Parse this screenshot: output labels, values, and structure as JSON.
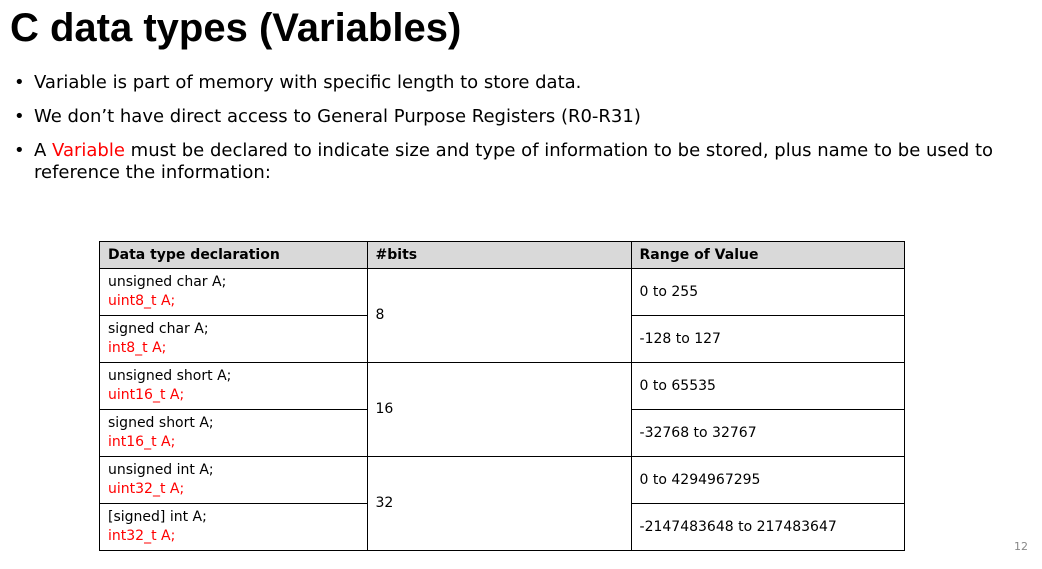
{
  "slide": {
    "title": "C data types (Variables)",
    "page_number": "12",
    "colors": {
      "accent": "#ff0000",
      "header_bg": "#d9d9d9"
    }
  },
  "bullets": [
    {
      "text": "Variable is part of memory with specific length to store data."
    },
    {
      "text": "We don’t have direct access to General Purpose Registers (R0-R31)"
    },
    {
      "pre": "A ",
      "highlight": "Variable",
      "post": " must be declared to indicate size and type of information to be stored, plus name to be used to reference the information:"
    }
  ],
  "table": {
    "headers": [
      "Data type declaration",
      "#bits",
      "Range of Value"
    ],
    "groups": [
      {
        "bits": "8",
        "rows": [
          {
            "decl": "unsigned char A;",
            "alias": "uint8_t A;",
            "range": "0 to 255"
          },
          {
            "decl": "signed char A;",
            "alias": "int8_t A;",
            "range": "-128 to 127"
          }
        ]
      },
      {
        "bits": "16",
        "rows": [
          {
            "decl": "unsigned short A;",
            "alias": "uint16_t A;",
            "range": "0 to 65535"
          },
          {
            "decl": "signed short A;",
            "alias": "int16_t A;",
            "range": "-32768 to 32767"
          }
        ]
      },
      {
        "bits": "32",
        "rows": [
          {
            "decl": "unsigned int A;",
            "alias": "uint32_t A;",
            "range": "0 to 4294967295"
          },
          {
            "decl": "[signed] int A;",
            "alias": "int32_t A;",
            "range": "-2147483648 to 217483647"
          }
        ]
      }
    ]
  }
}
